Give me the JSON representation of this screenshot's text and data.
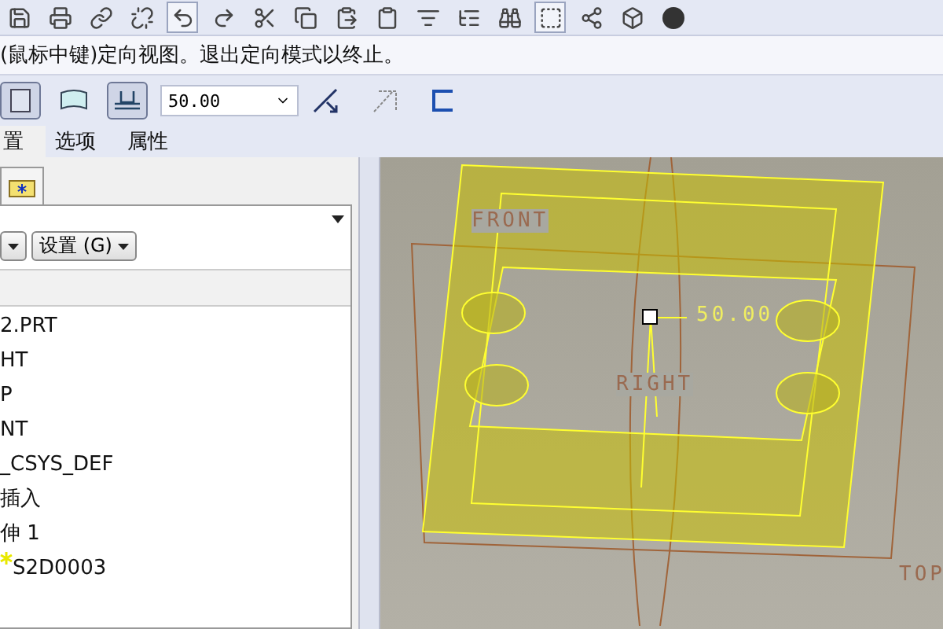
{
  "message": "(鼠标中键)定向视图。退出定向模式以终止。",
  "dashboard": {
    "tools": [
      {
        "kind": "solid",
        "selected": true
      },
      {
        "kind": "surface",
        "selected": false
      }
    ],
    "depth_button": {
      "selected": true
    },
    "depth_value": "50.00"
  },
  "tabs": [
    {
      "label": "置",
      "selected": true
    },
    {
      "label": "选项",
      "selected": false
    },
    {
      "label": "属性",
      "selected": false
    }
  ],
  "panel": {
    "settings_button": "设置 (G)",
    "tree": [
      {
        "kind": "part",
        "label": "2.PRT"
      },
      {
        "kind": "plane",
        "label": "HT"
      },
      {
        "kind": "plane",
        "label": "P"
      },
      {
        "kind": "plane",
        "label": "NT"
      },
      {
        "kind": "csys",
        "label": "_CSYS_DEF"
      },
      {
        "kind": "insert",
        "label": "插入"
      },
      {
        "kind": "feature",
        "label": "伸 1"
      },
      {
        "kind": "sketch",
        "label": "S2D0003"
      }
    ]
  },
  "viewport": {
    "labels": [
      {
        "kind": "plane",
        "text": "FRONT"
      },
      {
        "kind": "plane",
        "text": "RIGHT"
      },
      {
        "kind": "plane",
        "text": "TOP"
      },
      {
        "kind": "dimension",
        "text": "50.00"
      }
    ]
  }
}
